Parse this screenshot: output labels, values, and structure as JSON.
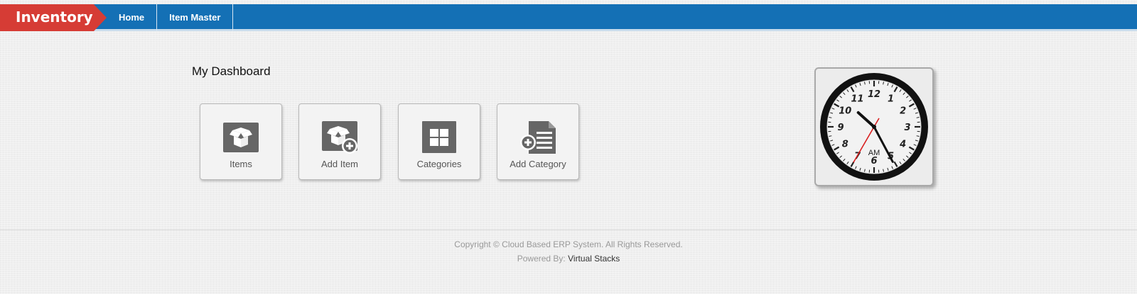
{
  "app": {
    "brand": "Inventory"
  },
  "nav": {
    "items": [
      {
        "label": "Home"
      },
      {
        "label": "Item Master"
      }
    ]
  },
  "dashboard": {
    "title": "My Dashboard",
    "tiles": [
      {
        "label": "Items",
        "icon": "items-box-icon"
      },
      {
        "label": "Add Item",
        "icon": "add-item-icon"
      },
      {
        "label": "Categories",
        "icon": "categories-grid-icon"
      },
      {
        "label": "Add Category",
        "icon": "add-category-document-icon"
      }
    ]
  },
  "clock": {
    "numerals": [
      "12",
      "1",
      "2",
      "3",
      "4",
      "5",
      "6",
      "7",
      "8",
      "9",
      "10",
      "11"
    ],
    "period": "AM",
    "hour": 10,
    "minute": 24,
    "second": 35
  },
  "footer": {
    "copyright": "Copyright © Cloud Based ERP System. All Rights Reserved.",
    "powered_label": "Powered By:",
    "powered_name": "Virtual Stacks"
  },
  "colors": {
    "topbar": "#1470b5",
    "brand": "#d63c35",
    "tile_icon": "#666666",
    "second_hand": "#d91f1f"
  }
}
